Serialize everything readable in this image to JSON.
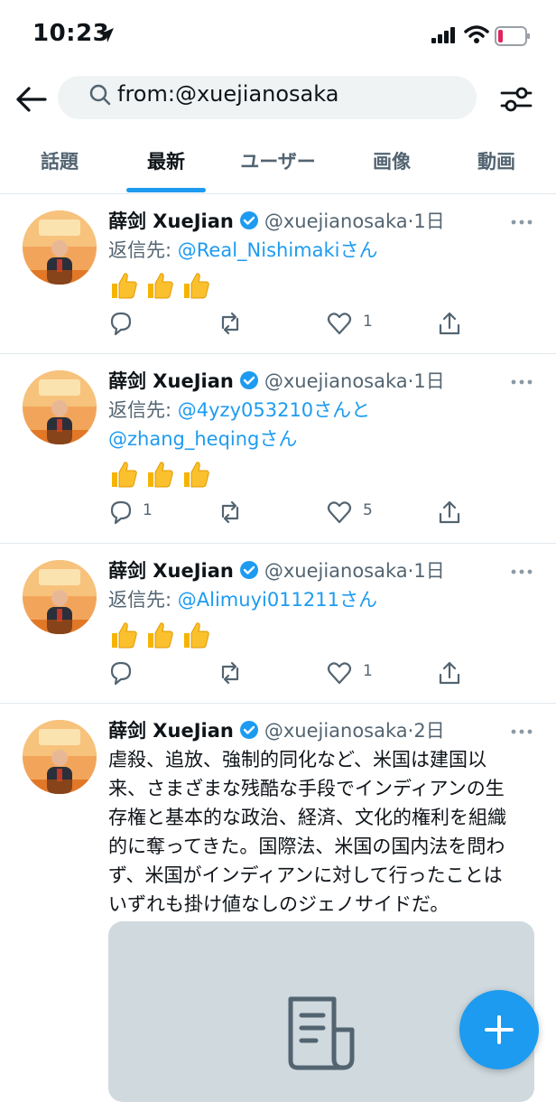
{
  "status_bar": {
    "time": "10:23"
  },
  "search": {
    "query": "from:@xuejianosaka"
  },
  "tabs": [
    {
      "label": "話題"
    },
    {
      "label": "最新"
    },
    {
      "label": "ユーザー"
    },
    {
      "label": "画像"
    },
    {
      "label": "動画"
    }
  ],
  "active_tab": "最新",
  "tweets": [
    {
      "name": "薛剑 XueJian",
      "handle": "@xuejianosaka",
      "time": "·1日",
      "reply_prefix": "返信先: ",
      "reply_line1_mention": "@Real_Nishimaki",
      "reply_line1_suffix": "さん",
      "reply_count": "",
      "like_count": "1"
    },
    {
      "name": "薛剑 XueJian",
      "handle": "@xuejianosaka",
      "time": "·1日",
      "reply_prefix": "返信先: ",
      "reply_line1_mention": "@4yzy053210",
      "reply_line1_suffix": "さんと",
      "reply_line2_mention": "@zhang_heqing",
      "reply_line2_suffix": "さん",
      "reply_count": "1",
      "like_count": "5"
    },
    {
      "name": "薛剑 XueJian",
      "handle": "@xuejianosaka",
      "time": "·1日",
      "reply_prefix": "返信先: ",
      "reply_line1_mention": "@Alimuyi011211",
      "reply_line1_suffix": "さん",
      "reply_count": "",
      "like_count": "1"
    },
    {
      "name": "薛剑 XueJian",
      "handle": "@xuejianosaka",
      "time": "·2日",
      "text_lines": [
        "虐殺、追放、強制的同化など、米国は建国以",
        "来、さまざまな残酷な手段でインディアンの生",
        "存権と基本的な政治、経済、文化的権利を組織",
        "的に奪ってきた。国際法、米国の国内法を問わ",
        "ず、米国がインディアンに対して行ったことは",
        "いずれも掛け値なしのジェノサイドだ。"
      ]
    }
  ],
  "icons": {
    "back": "arrow-left-icon",
    "search": "search-icon",
    "filter": "sliders-icon",
    "reply": "comment-icon",
    "retweet": "retweet-icon",
    "like": "heart-icon",
    "share": "share-icon",
    "compose": "plus-icon"
  },
  "colors": {
    "accent": "#1d9bf0",
    "muted": "#536471",
    "text": "#0f1419"
  }
}
